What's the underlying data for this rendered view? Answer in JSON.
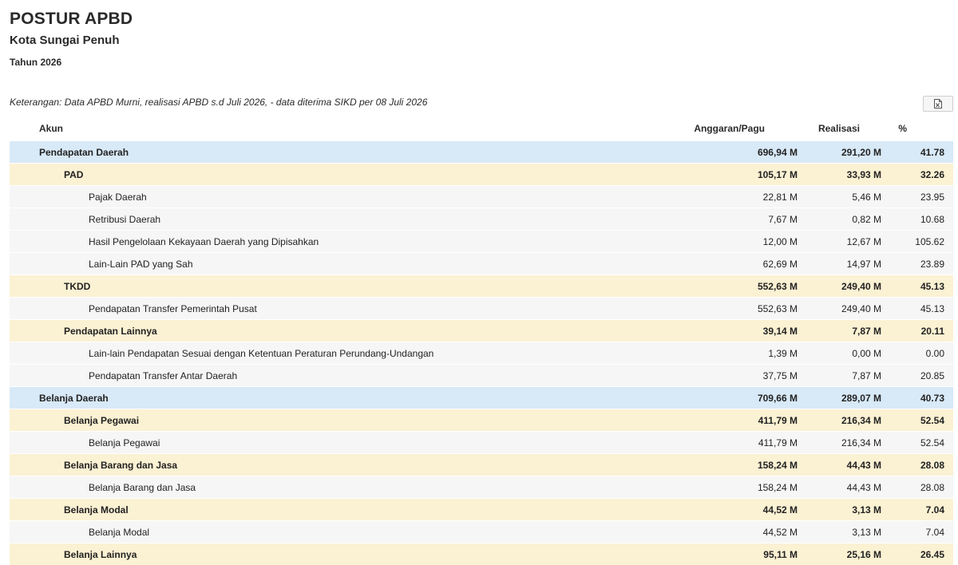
{
  "header": {
    "title": "POSTUR APBD",
    "subtitle": "Kota Sungai Penuh",
    "year": "Tahun 2026",
    "note": "Keterangan: Data APBD Murni, realisasi APBD s.d Juli 2026, - data diterima SIKD per 08 Juli 2026"
  },
  "export_icon": "excel-export-icon",
  "colors": {
    "level0": "#d8e9f7",
    "level1": "#fbf1d3",
    "level2": "#f6f6f6"
  },
  "table": {
    "columns": [
      "Akun",
      "Anggaran/Pagu",
      "Realisasi",
      "%"
    ],
    "rows": [
      {
        "level": 0,
        "akun": "Pendapatan Daerah",
        "anggaran": "696,94 M",
        "realisasi": "291,20 M",
        "persen": "41.78"
      },
      {
        "level": 1,
        "akun": "PAD",
        "anggaran": "105,17 M",
        "realisasi": "33,93 M",
        "persen": "32.26"
      },
      {
        "level": 2,
        "akun": "Pajak Daerah",
        "anggaran": "22,81 M",
        "realisasi": "5,46 M",
        "persen": "23.95"
      },
      {
        "level": 2,
        "akun": "Retribusi Daerah",
        "anggaran": "7,67 M",
        "realisasi": "0,82 M",
        "persen": "10.68"
      },
      {
        "level": 2,
        "akun": "Hasil Pengelolaan Kekayaan Daerah yang Dipisahkan",
        "anggaran": "12,00 M",
        "realisasi": "12,67 M",
        "persen": "105.62"
      },
      {
        "level": 2,
        "akun": "Lain-Lain PAD yang Sah",
        "anggaran": "62,69 M",
        "realisasi": "14,97 M",
        "persen": "23.89"
      },
      {
        "level": 1,
        "akun": "TKDD",
        "anggaran": "552,63 M",
        "realisasi": "249,40 M",
        "persen": "45.13"
      },
      {
        "level": 2,
        "akun": "Pendapatan Transfer Pemerintah Pusat",
        "anggaran": "552,63 M",
        "realisasi": "249,40 M",
        "persen": "45.13"
      },
      {
        "level": 1,
        "akun": "Pendapatan Lainnya",
        "anggaran": "39,14 M",
        "realisasi": "7,87 M",
        "persen": "20.11"
      },
      {
        "level": 2,
        "akun": "Lain-lain Pendapatan Sesuai dengan Ketentuan Peraturan Perundang-Undangan",
        "anggaran": "1,39 M",
        "realisasi": "0,00 M",
        "persen": "0.00"
      },
      {
        "level": 2,
        "akun": "Pendapatan Transfer Antar Daerah",
        "anggaran": "37,75 M",
        "realisasi": "7,87 M",
        "persen": "20.85"
      },
      {
        "level": 0,
        "akun": "Belanja Daerah",
        "anggaran": "709,66 M",
        "realisasi": "289,07 M",
        "persen": "40.73"
      },
      {
        "level": 1,
        "akun": "Belanja Pegawai",
        "anggaran": "411,79 M",
        "realisasi": "216,34 M",
        "persen": "52.54"
      },
      {
        "level": 2,
        "akun": "Belanja Pegawai",
        "anggaran": "411,79 M",
        "realisasi": "216,34 M",
        "persen": "52.54"
      },
      {
        "level": 1,
        "akun": "Belanja Barang dan Jasa",
        "anggaran": "158,24 M",
        "realisasi": "44,43 M",
        "persen": "28.08"
      },
      {
        "level": 2,
        "akun": "Belanja Barang dan Jasa",
        "anggaran": "158,24 M",
        "realisasi": "44,43 M",
        "persen": "28.08"
      },
      {
        "level": 1,
        "akun": "Belanja Modal",
        "anggaran": "44,52 M",
        "realisasi": "3,13 M",
        "persen": "7.04"
      },
      {
        "level": 2,
        "akun": "Belanja Modal",
        "anggaran": "44,52 M",
        "realisasi": "3,13 M",
        "persen": "7.04"
      },
      {
        "level": 1,
        "akun": "Belanja Lainnya",
        "anggaran": "95,11 M",
        "realisasi": "25,16 M",
        "persen": "26.45"
      }
    ]
  }
}
